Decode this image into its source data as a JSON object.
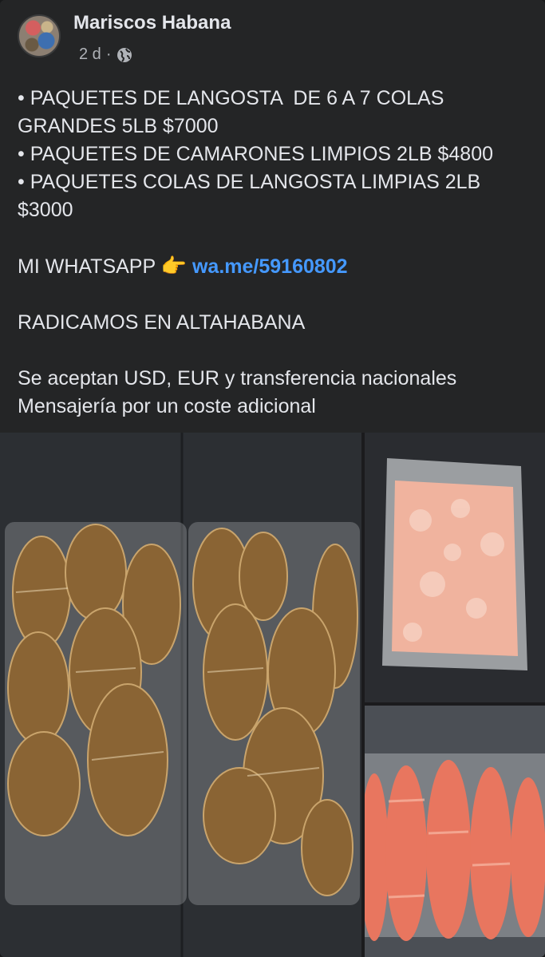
{
  "post": {
    "author": "Mariscos Habana",
    "time": "2 d",
    "dot": "·",
    "lines": [
      "• PAQUETES DE LANGOSTA  DE 6 A 7 COLAS GRANDES 5LB $7000",
      "• PAQUETES DE CAMARONES LIMPIOS 2LB $4800",
      "• PAQUETES COLAS DE LANGOSTA LIMPIAS 2LB $3000"
    ],
    "whatsapp_label": "MI WHATSAPP ",
    "whatsapp_emoji": "👉",
    "whatsapp_link": "wa.me/59160802",
    "location": "RADICAMOS EN ALTAHABANA",
    "payment": "Se aceptan USD, EUR y transferencia nacionales",
    "delivery": "Mensajería por un coste adicional"
  },
  "icons": {
    "privacy": "globe-icon",
    "hand": "pointing-hand-emoji"
  },
  "colors": {
    "background": "#242526",
    "text": "#e4e6eb",
    "secondary": "#b0b3b8",
    "link": "#4599ff"
  }
}
